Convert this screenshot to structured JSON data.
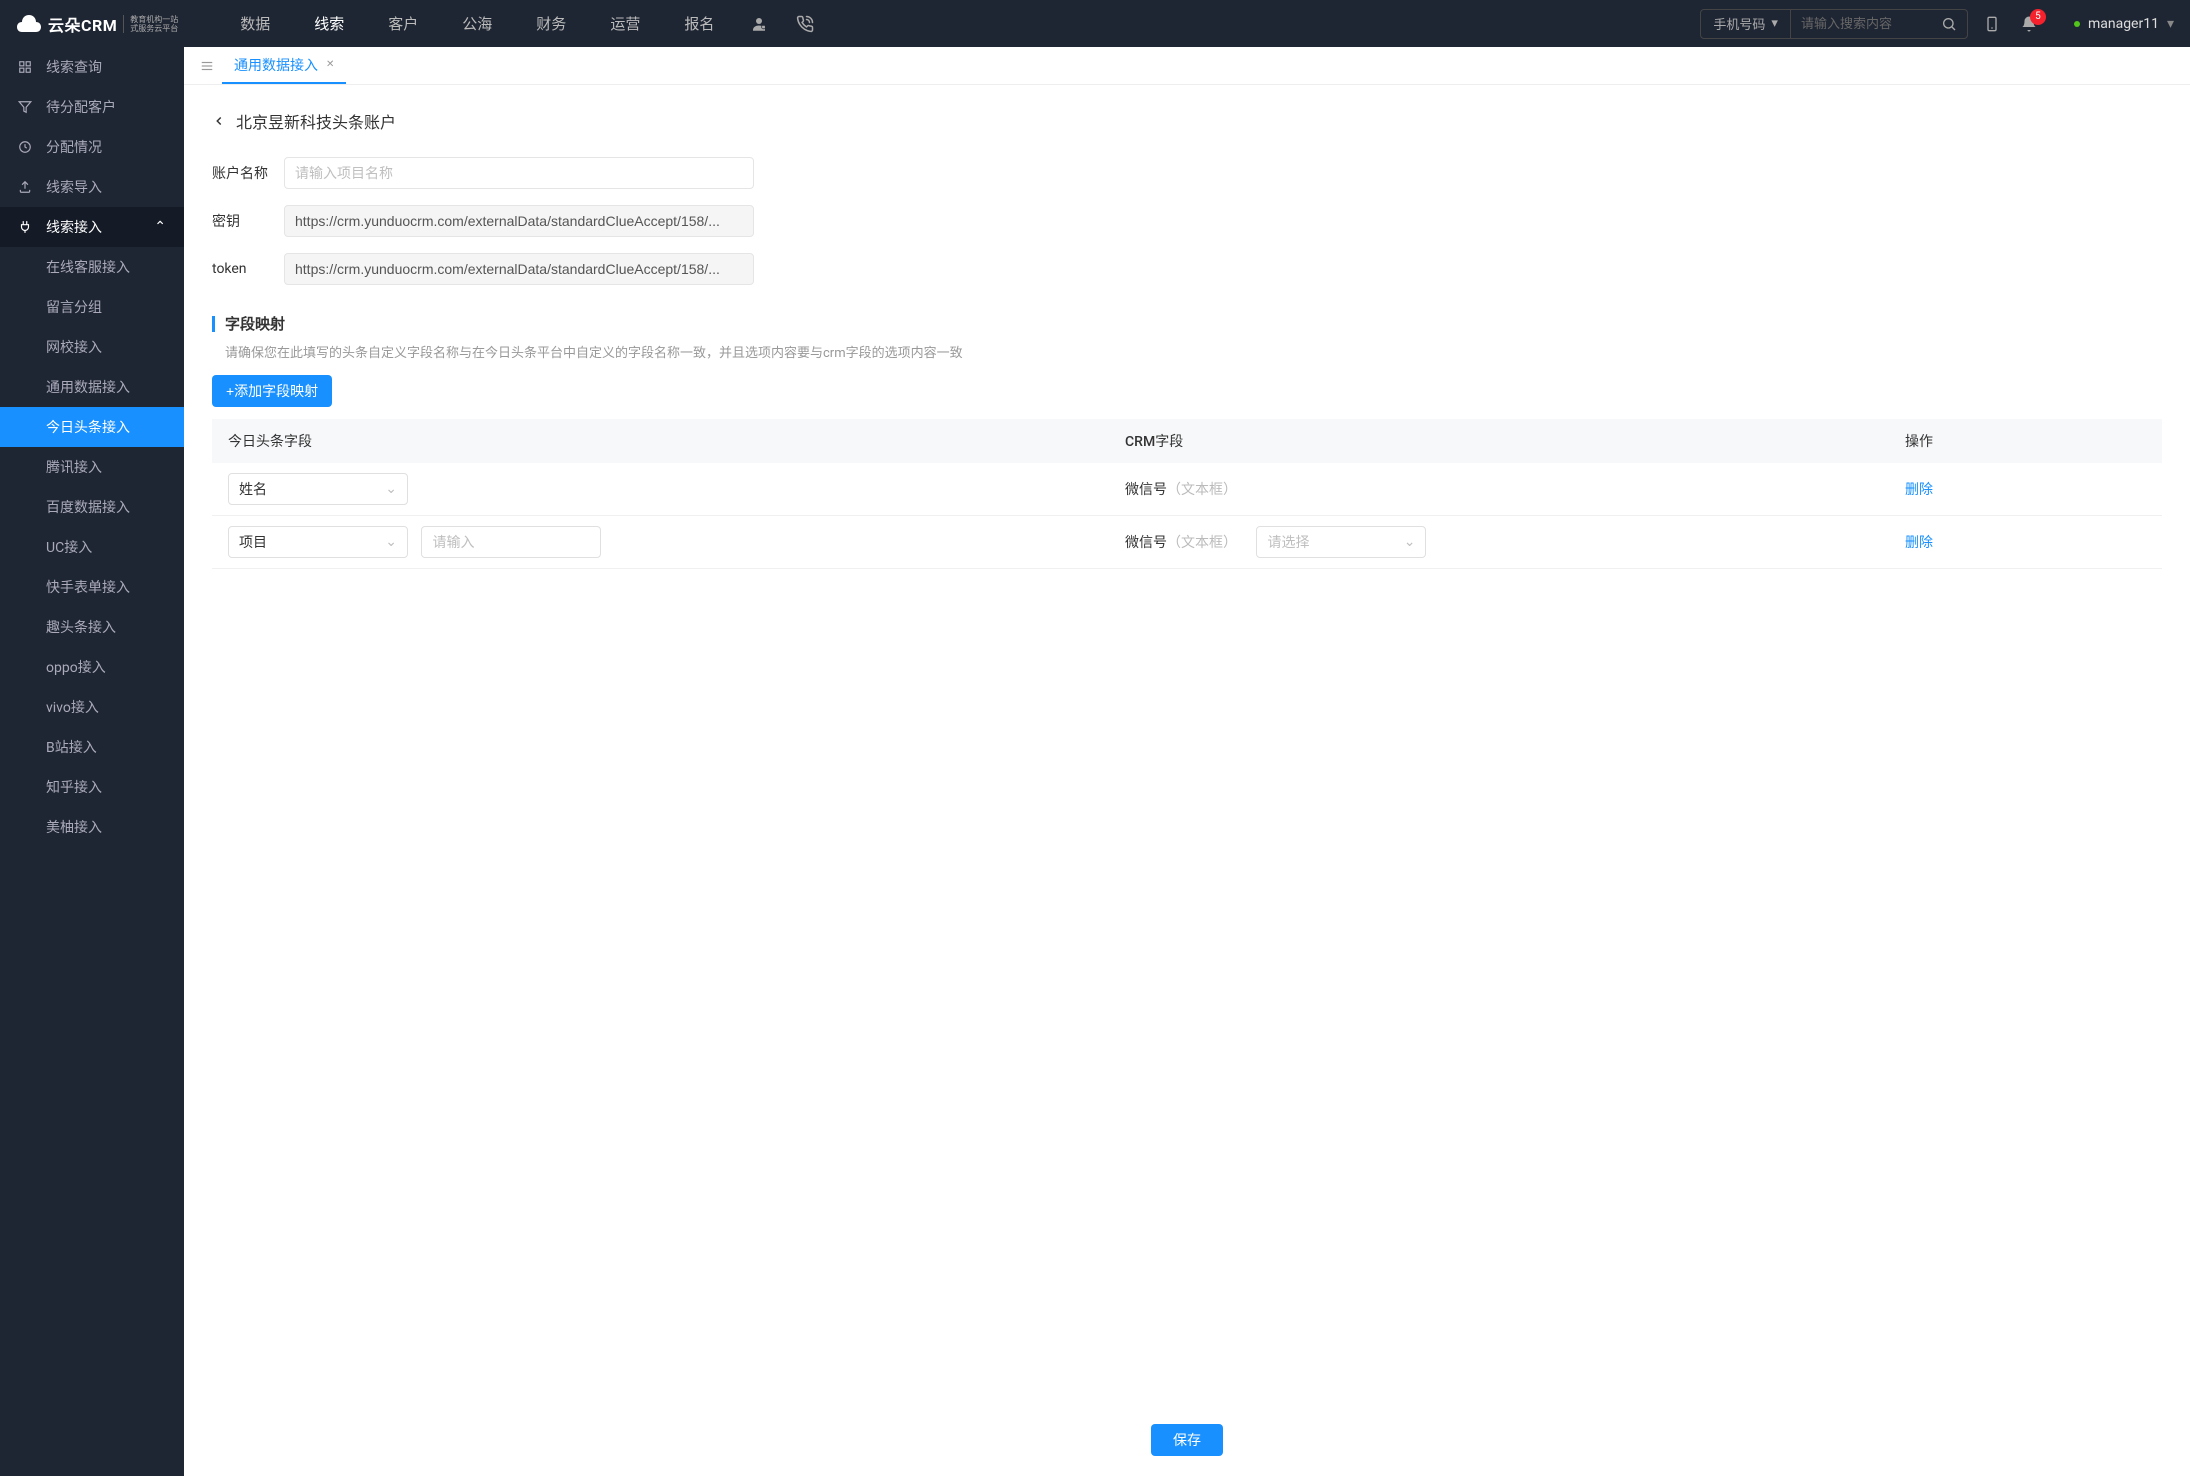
{
  "header": {
    "logo_brand": "云朵CRM",
    "logo_sub1": "教育机构一站",
    "logo_sub2": "式服务云平台",
    "nav": [
      "数据",
      "线索",
      "客户",
      "公海",
      "财务",
      "运营",
      "报名"
    ],
    "nav_active": "线索",
    "search_type": "手机号码",
    "search_placeholder": "请输入搜索内容",
    "badge_count": "5",
    "username": "manager11"
  },
  "sidebar": {
    "items": [
      {
        "label": "线索查询",
        "icon": "grid"
      },
      {
        "label": "待分配客户",
        "icon": "filter"
      },
      {
        "label": "分配情况",
        "icon": "clock"
      },
      {
        "label": "线索导入",
        "icon": "upload"
      },
      {
        "label": "线索接入",
        "icon": "plug",
        "expanded": true,
        "children": [
          "在线客服接入",
          "留言分组",
          "网校接入",
          "通用数据接入",
          "今日头条接入",
          "腾讯接入",
          "百度数据接入",
          "UC接入",
          "快手表单接入",
          "趣头条接入",
          "oppo接入",
          "vivo接入",
          "B站接入",
          "知乎接入",
          "美柚接入"
        ]
      }
    ],
    "active_sub": "今日头条接入"
  },
  "tabs": {
    "items": [
      {
        "label": "通用数据接入",
        "active": true
      }
    ]
  },
  "page": {
    "title": "北京昱新科技头条账户",
    "form": {
      "name_label": "账户名称",
      "name_placeholder": "请输入项目名称",
      "secret_label": "密钥",
      "secret_value": "https://crm.yunduocrm.com/externalData/standardClueAccept/158/...",
      "token_label": "token",
      "token_value": "https://crm.yunduocrm.com/externalData/standardClueAccept/158/..."
    },
    "mapping": {
      "section_title": "字段映射",
      "hint": "请确保您在此填写的头条自定义字段名称与在今日头条平台中自定义的字段名称一致，并且选项内容要与crm字段的选项内容一致",
      "add_button": "+添加字段映射",
      "columns": {
        "src": "今日头条字段",
        "dst": "CRM字段",
        "op": "操作"
      },
      "rows": [
        {
          "src_select": "姓名",
          "crm_label": "微信号",
          "crm_hint": "（文本框）",
          "action": "删除"
        },
        {
          "src_select": "项目",
          "input_placeholder": "请输入",
          "crm_label": "微信号",
          "crm_hint": "（文本框）",
          "crm_select_placeholder": "请选择",
          "action": "删除"
        }
      ]
    },
    "save_button": "保存"
  }
}
